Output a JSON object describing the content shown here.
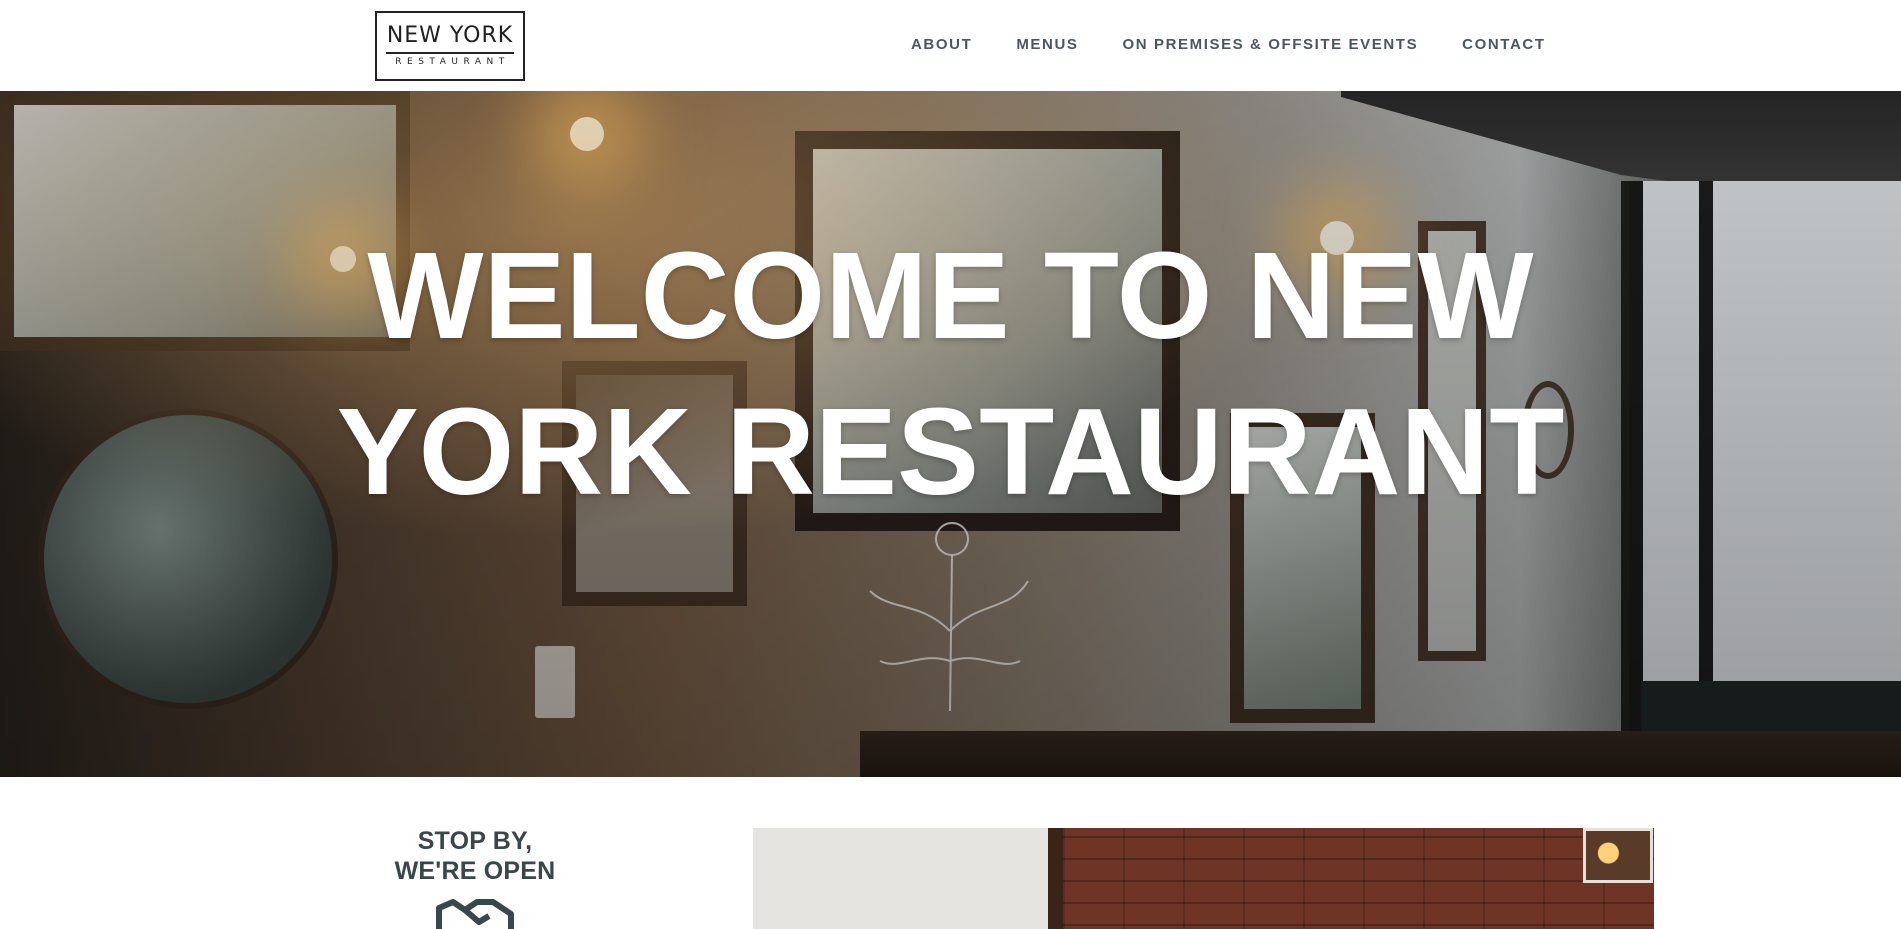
{
  "header": {
    "logo": {
      "main": "NEW YORK",
      "sub": "RESTAURANT"
    },
    "nav": [
      {
        "label": "ABOUT"
      },
      {
        "label": "MENUS"
      },
      {
        "label": "ON PREMISES & OFFSITE EVENTS"
      },
      {
        "label": "CONTACT"
      }
    ]
  },
  "hero": {
    "title_line1": "WELCOME TO NEW",
    "title_line2": "YORK RESTAURANT"
  },
  "open_section": {
    "line1": "STOP BY,",
    "line2": "WE'RE OPEN",
    "icon": "handshake-icon"
  },
  "colors": {
    "heading": "#38474a",
    "nav": "#4a585e",
    "hero_text": "#ffffff"
  }
}
